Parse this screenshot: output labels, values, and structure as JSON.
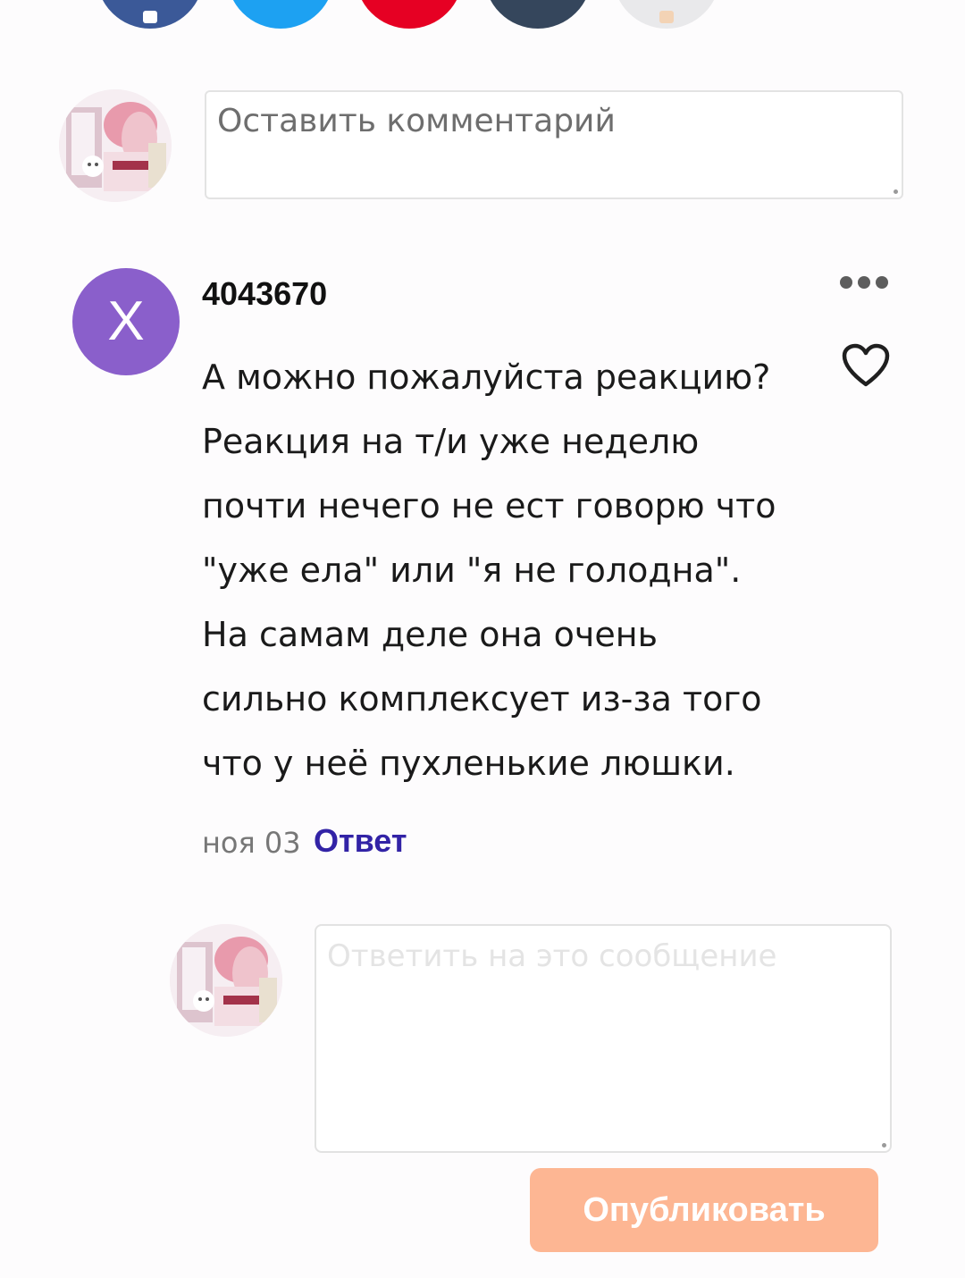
{
  "share": {
    "buttons": [
      {
        "name": "facebook",
        "color": "#3b5998"
      },
      {
        "name": "twitter",
        "color": "#1da1f2"
      },
      {
        "name": "pinterest",
        "color": "#e60023"
      },
      {
        "name": "tumblr",
        "color": "#35465c"
      },
      {
        "name": "more",
        "color": "#e9e9eb"
      }
    ]
  },
  "new_comment": {
    "placeholder": "Оставить комментарий"
  },
  "comment": {
    "avatar_letter": "X",
    "avatar_color": "#8a5fcb",
    "username": "4043670",
    "text_lines": [
      "А можно пожалуйста реакцию?",
      "Реакция на т/и уже неделю",
      "почти нечего не ест говорю что",
      "\"уже ела\" или \"я не голодна\".",
      "На самам деле она очень",
      "сильно комплексует из-за того",
      "что у неё пухленькие люшки."
    ],
    "date": "ноя 03",
    "reply_label": "Ответ",
    "reply_color": "#3223a6"
  },
  "reply_form": {
    "placeholder": "Ответить на это сообщение",
    "publish_label": "Опубликовать",
    "publish_color": "#fdb693"
  }
}
